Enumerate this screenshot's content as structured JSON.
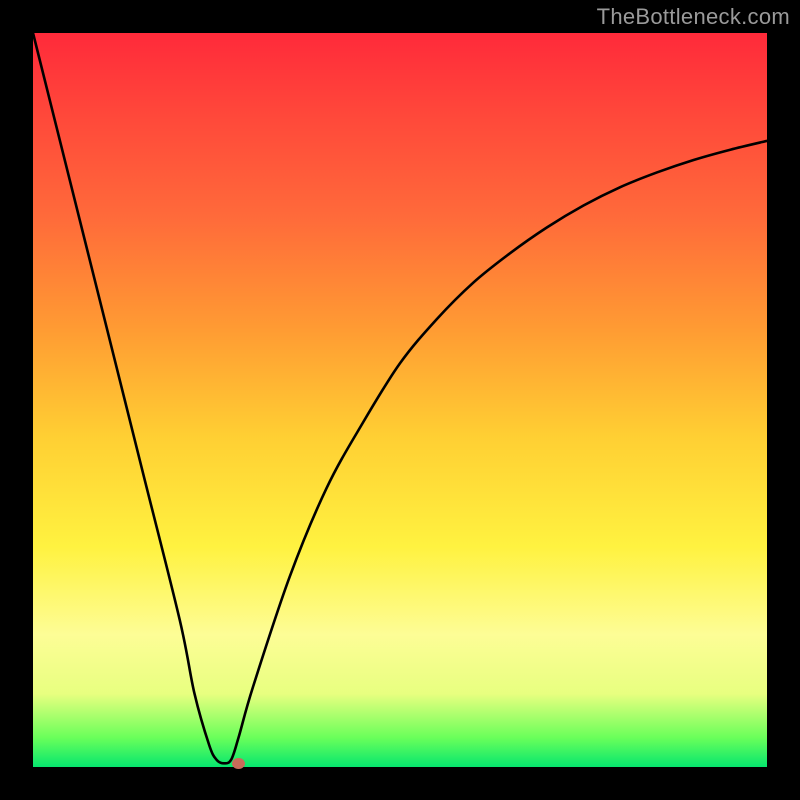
{
  "attribution": "TheBottleneck.com",
  "chart_data": {
    "type": "line",
    "title": "",
    "xlabel": "",
    "ylabel": "",
    "xlim": [
      0,
      100
    ],
    "ylim": [
      0,
      100
    ],
    "grid": false,
    "legend": false,
    "series": [
      {
        "name": "bottleneck-curve",
        "x": [
          0,
          5,
          10,
          15,
          20,
          22,
          24,
          25,
          26,
          27,
          28,
          30,
          35,
          40,
          45,
          50,
          55,
          60,
          65,
          70,
          75,
          80,
          85,
          90,
          95,
          100
        ],
        "values": [
          100,
          80,
          60,
          40,
          20,
          10,
          3,
          1,
          0.5,
          1,
          4,
          11,
          26,
          38,
          47,
          55,
          61,
          66,
          70,
          73.5,
          76.5,
          79,
          81,
          82.7,
          84.1,
          85.3
        ]
      }
    ],
    "marker": {
      "x": 28,
      "y": 0.5,
      "color": "#c96b5a"
    },
    "background_gradient": {
      "top": "#ff2a3a",
      "bottom": "#06e66e",
      "stops": [
        "#ff2a3a",
        "#ff6a3a",
        "#ffcf33",
        "#fdfd96",
        "#06e66e"
      ]
    }
  }
}
